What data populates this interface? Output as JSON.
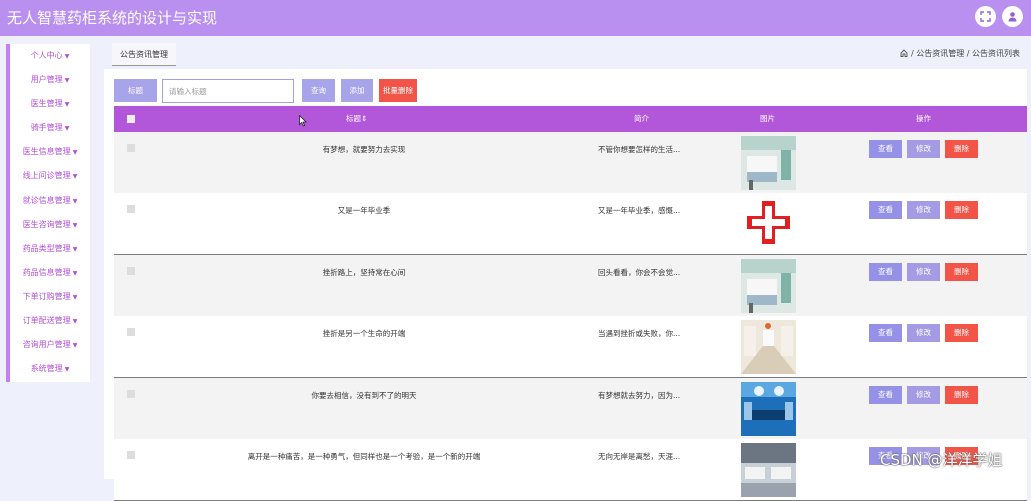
{
  "app_title": "无人智慧药柜系统的设计与实现",
  "icons": {
    "fullscreen": "fullscreen-icon",
    "user": "user-icon",
    "home": "home-icon"
  },
  "sidebar": {
    "items": [
      {
        "label": "个人中心"
      },
      {
        "label": "用户管理"
      },
      {
        "label": "医生管理"
      },
      {
        "label": "骑手管理"
      },
      {
        "label": "医生信息管理"
      },
      {
        "label": "线上问诊管理"
      },
      {
        "label": "就诊信息管理"
      },
      {
        "label": "医生咨询管理"
      },
      {
        "label": "药品类型管理"
      },
      {
        "label": "药品信息管理"
      },
      {
        "label": "下单订购管理"
      },
      {
        "label": "订单配送管理"
      },
      {
        "label": "咨询用户管理"
      },
      {
        "label": "系统管理"
      }
    ]
  },
  "tab": {
    "label": "公告资讯管理"
  },
  "breadcrumb": {
    "part1": "公告资讯管理",
    "sep": "/",
    "part2": "公告资讯列表"
  },
  "search": {
    "label": "标题",
    "placeholder": "请输入标题",
    "query_button": "查询",
    "add_button": "添加",
    "batch_delete_button": "批量删除"
  },
  "table": {
    "headers": {
      "title": "标题",
      "sort_mark": "⇕",
      "summary": "简介",
      "image": "图片",
      "actions": "操作"
    },
    "action_labels": {
      "view": "查看",
      "edit": "修改",
      "delete": "删除"
    },
    "rows": [
      {
        "title": "有梦想，就要努力去实现",
        "summary": "不管你想要怎样的生活...",
        "image": "hospital-room-photo"
      },
      {
        "title": "又是一年毕业季",
        "summary": "又是一年毕业季，感慨...",
        "image": "red-cross-logo"
      },
      {
        "title": "挫折路上，坚持常在心间",
        "summary": "回头看看，你会不会觉...",
        "image": "hospital-room-photo"
      },
      {
        "title": "挫折是另一个生命的开端",
        "summary": "当遇到挫折或失败，你...",
        "image": "hospital-corridor-photo"
      },
      {
        "title": "你要去相信，没有到不了的明天",
        "summary": "有梦想就去努力，因为...",
        "image": "operating-room-photo"
      },
      {
        "title": "离开是一种痛苦，是一种勇气，但同样也是一个考验，是一个新的开端",
        "summary": "无向无岸是离愁，天涯...",
        "image": "ward-photo"
      }
    ]
  },
  "watermark": "CSDN @洋洋学姐",
  "colors": {
    "topbar": "#b98ff0",
    "table_header": "#b256da",
    "delete": "#f25548",
    "view": "#9591e6",
    "sidebar_text": "#b14fd3"
  }
}
